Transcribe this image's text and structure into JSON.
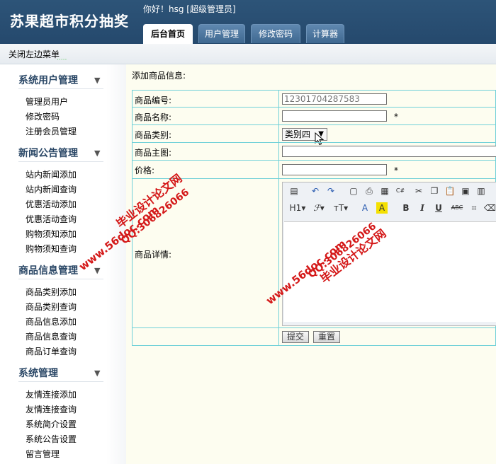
{
  "header": {
    "app_title": "苏果超市积分抽奖",
    "greeting": "你好！hsg [超级管理员]",
    "tabs": [
      {
        "label": "后台首页",
        "active": true
      },
      {
        "label": "用户管理",
        "active": false
      },
      {
        "label": "修改密码",
        "active": false
      },
      {
        "label": "计算器",
        "active": false
      }
    ]
  },
  "topbar": {
    "toggle_menu_label": "关闭左边菜单"
  },
  "sidebar": {
    "groups": [
      {
        "title": "系统用户管理",
        "items": [
          "管理员用户",
          "修改密码",
          "注册会员管理"
        ]
      },
      {
        "title": "新闻公告管理",
        "items": [
          "站内新闻添加",
          "站内新闻查询",
          "优惠活动添加",
          "优惠活动查询",
          "购物须知添加",
          "购物须知查询"
        ]
      },
      {
        "title": "商品信息管理",
        "items": [
          "商品类别添加",
          "商品类别查询",
          "商品信息添加",
          "商品信息查询",
          "商品订单查询"
        ]
      },
      {
        "title": "系统管理",
        "items": [
          "友情连接添加",
          "友情连接查询",
          "系统简介设置",
          "系统公告设置",
          "留言管理"
        ]
      }
    ]
  },
  "form": {
    "section_title": "添加商品信息:",
    "fields": {
      "code": {
        "label": "商品编号:",
        "value": "12301704287583"
      },
      "name": {
        "label": "商品名称:",
        "value": "",
        "required_mark": "*"
      },
      "category": {
        "label": "商品类别:",
        "selected": "类别四"
      },
      "image": {
        "label": "商品主图:",
        "value": ""
      },
      "price": {
        "label": "价格:",
        "value": "",
        "required_mark": "*"
      },
      "detail": {
        "label": "商品详情:"
      }
    },
    "editor_toolbar": {
      "heading_label": "H1",
      "bold_label": "B",
      "italic_label": "I",
      "underline_label": "U",
      "strike_label": "ABC"
    },
    "submit_label": "提交",
    "reset_label": "重置"
  },
  "watermarks": {
    "site": "www.56doc.com",
    "qq": "QQ:306826066",
    "name": "毕业设计论文网"
  },
  "colors": {
    "header_bg": "#2d5478",
    "table_border": "#6fd0d8",
    "sidebar_title": "#2a4766",
    "watermark": "#d41818"
  }
}
